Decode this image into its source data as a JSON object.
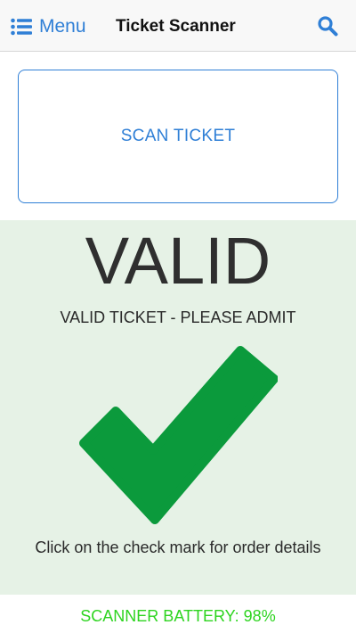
{
  "navbar": {
    "menu_label": "Menu",
    "menu_icon": "list-icon",
    "title": "Ticket Scanner",
    "search_icon": "search-icon",
    "accent_color": "#2f7fd6"
  },
  "scan": {
    "button_label": "SCAN TICKET"
  },
  "result": {
    "status": "VALID",
    "message": "VALID TICKET - PLEASE ADMIT",
    "icon": "checkmark-icon",
    "icon_color": "#0b9a3c",
    "panel_color": "#e6f2e6",
    "hint": "Click on the check mark for order details"
  },
  "footer": {
    "battery_text": "SCANNER BATTERY: 98%",
    "battery_level": 98,
    "battery_color": "#2dd41f"
  }
}
